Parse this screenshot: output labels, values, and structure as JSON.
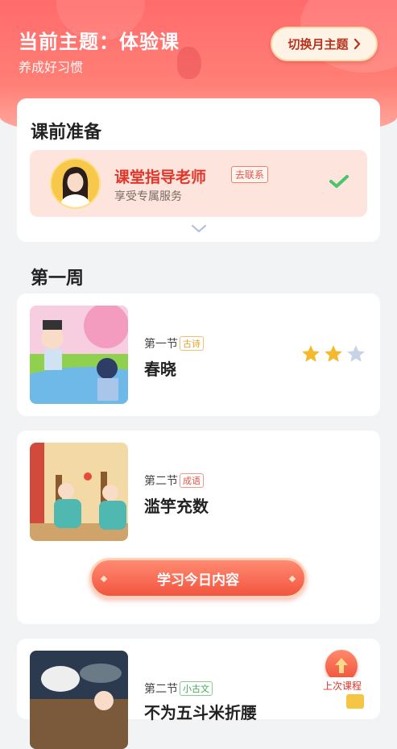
{
  "header": {
    "theme_title": "当前主题：体验课",
    "subtitle": "养成好习惯",
    "switch_label": "切换月主题"
  },
  "prep": {
    "title": "课前准备",
    "teacher_name": "课堂指导老师",
    "contact_tag": "去联系",
    "teacher_sub": "享受专属服务"
  },
  "week": {
    "title": "第一周"
  },
  "lessons": [
    {
      "section": "第一节",
      "tag": "古诗",
      "name": "春晓",
      "stars_filled": 2,
      "stars_total": 3
    },
    {
      "section": "第二节",
      "tag": "成语",
      "name": "滥竽充数",
      "button": "学习今日内容"
    },
    {
      "section": "第二节",
      "tag": "小古文",
      "name": "不为五斗米折腰"
    }
  ],
  "floating": {
    "last_course_label": "上次课程"
  },
  "colors": {
    "accent": "#f2553f",
    "header": "#ff6b6b",
    "star_on": "#f5b92e",
    "star_off": "#c8d3e6"
  }
}
